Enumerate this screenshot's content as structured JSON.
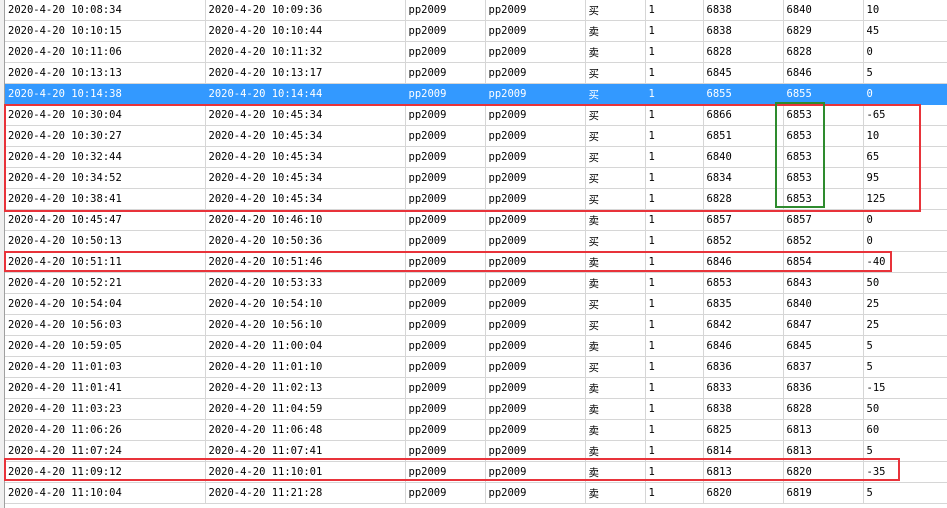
{
  "rows": [
    [
      "2020-4-20 10:08:34",
      "2020-4-20 10:09:36",
      "pp2009",
      "pp2009",
      "买",
      "1",
      "6838",
      "6840",
      "10"
    ],
    [
      "2020-4-20 10:10:15",
      "2020-4-20 10:10:44",
      "pp2009",
      "pp2009",
      "卖",
      "1",
      "6838",
      "6829",
      "45"
    ],
    [
      "2020-4-20 10:11:06",
      "2020-4-20 10:11:32",
      "pp2009",
      "pp2009",
      "卖",
      "1",
      "6828",
      "6828",
      "0"
    ],
    [
      "2020-4-20 10:13:13",
      "2020-4-20 10:13:17",
      "pp2009",
      "pp2009",
      "买",
      "1",
      "6845",
      "6846",
      "5"
    ],
    [
      "2020-4-20 10:14:38",
      "2020-4-20 10:14:44",
      "pp2009",
      "pp2009",
      "买",
      "1",
      "6855",
      "6855",
      "0"
    ],
    [
      "2020-4-20 10:30:04",
      "2020-4-20 10:45:34",
      "pp2009",
      "pp2009",
      "买",
      "1",
      "6866",
      "6853",
      "-65"
    ],
    [
      "2020-4-20 10:30:27",
      "2020-4-20 10:45:34",
      "pp2009",
      "pp2009",
      "买",
      "1",
      "6851",
      "6853",
      "10"
    ],
    [
      "2020-4-20 10:32:44",
      "2020-4-20 10:45:34",
      "pp2009",
      "pp2009",
      "买",
      "1",
      "6840",
      "6853",
      "65"
    ],
    [
      "2020-4-20 10:34:52",
      "2020-4-20 10:45:34",
      "pp2009",
      "pp2009",
      "买",
      "1",
      "6834",
      "6853",
      "95"
    ],
    [
      "2020-4-20 10:38:41",
      "2020-4-20 10:45:34",
      "pp2009",
      "pp2009",
      "买",
      "1",
      "6828",
      "6853",
      "125"
    ],
    [
      "2020-4-20 10:45:47",
      "2020-4-20 10:46:10",
      "pp2009",
      "pp2009",
      "卖",
      "1",
      "6857",
      "6857",
      "0"
    ],
    [
      "2020-4-20 10:50:13",
      "2020-4-20 10:50:36",
      "pp2009",
      "pp2009",
      "买",
      "1",
      "6852",
      "6852",
      "0"
    ],
    [
      "2020-4-20 10:51:11",
      "2020-4-20 10:51:46",
      "pp2009",
      "pp2009",
      "卖",
      "1",
      "6846",
      "6854",
      "-40"
    ],
    [
      "2020-4-20 10:52:21",
      "2020-4-20 10:53:33",
      "pp2009",
      "pp2009",
      "卖",
      "1",
      "6853",
      "6843",
      "50"
    ],
    [
      "2020-4-20 10:54:04",
      "2020-4-20 10:54:10",
      "pp2009",
      "pp2009",
      "买",
      "1",
      "6835",
      "6840",
      "25"
    ],
    [
      "2020-4-20 10:56:03",
      "2020-4-20 10:56:10",
      "pp2009",
      "pp2009",
      "买",
      "1",
      "6842",
      "6847",
      "25"
    ],
    [
      "2020-4-20 10:59:05",
      "2020-4-20 11:00:04",
      "pp2009",
      "pp2009",
      "卖",
      "1",
      "6846",
      "6845",
      "5"
    ],
    [
      "2020-4-20 11:01:03",
      "2020-4-20 11:01:10",
      "pp2009",
      "pp2009",
      "买",
      "1",
      "6836",
      "6837",
      "5"
    ],
    [
      "2020-4-20 11:01:41",
      "2020-4-20 11:02:13",
      "pp2009",
      "pp2009",
      "卖",
      "1",
      "6833",
      "6836",
      "-15"
    ],
    [
      "2020-4-20 11:03:23",
      "2020-4-20 11:04:59",
      "pp2009",
      "pp2009",
      "卖",
      "1",
      "6838",
      "6828",
      "50"
    ],
    [
      "2020-4-20 11:06:26",
      "2020-4-20 11:06:48",
      "pp2009",
      "pp2009",
      "卖",
      "1",
      "6825",
      "6813",
      "60"
    ],
    [
      "2020-4-20 11:07:24",
      "2020-4-20 11:07:41",
      "pp2009",
      "pp2009",
      "卖",
      "1",
      "6814",
      "6813",
      "5"
    ],
    [
      "2020-4-20 11:09:12",
      "2020-4-20 11:10:01",
      "pp2009",
      "pp2009",
      "卖",
      "1",
      "6813",
      "6820",
      "-35"
    ],
    [
      "2020-4-20 11:10:04",
      "2020-4-20 11:21:28",
      "pp2009",
      "pp2009",
      "卖",
      "1",
      "6820",
      "6819",
      "5"
    ]
  ],
  "selected_row": 4,
  "colors": {
    "selection": "#3399ff",
    "red_highlight": "#e8333a",
    "green_highlight": "#2e8b2e"
  }
}
